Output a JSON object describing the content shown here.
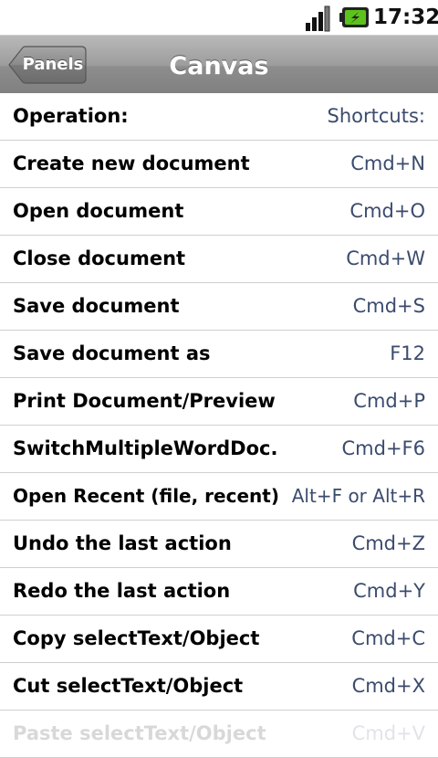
{
  "status_bar": {
    "time": "17:32",
    "icons": [
      "signal-icon",
      "battery-charging-icon"
    ]
  },
  "title_bar": {
    "back_label": "Panels",
    "title": "Canvas"
  },
  "header": {
    "operation": "Operation:",
    "shortcut": "Shortcuts:"
  },
  "rows": [
    {
      "operation": "Create new document",
      "shortcut": "Cmd+N"
    },
    {
      "operation": "Open document",
      "shortcut": "Cmd+O"
    },
    {
      "operation": "Close document",
      "shortcut": "Cmd+W"
    },
    {
      "operation": "Save document",
      "shortcut": "Cmd+S"
    },
    {
      "operation": "Save document as",
      "shortcut": "F12"
    },
    {
      "operation": "Print Document/Preview",
      "shortcut": "Cmd+P"
    },
    {
      "operation": "SwitchMultipleWordDoc.",
      "shortcut": "Cmd+F6"
    },
    {
      "operation": "Open Recent (file, recent)",
      "shortcut": "Alt+F or Alt+R"
    },
    {
      "operation": "Undo the last action",
      "shortcut": "Cmd+Z"
    },
    {
      "operation": "Redo the last action",
      "shortcut": "Cmd+Y"
    },
    {
      "operation": "Copy selectText/Object",
      "shortcut": "Cmd+C"
    },
    {
      "operation": "Cut selectText/Object",
      "shortcut": "Cmd+X"
    },
    {
      "operation": "Paste selectText/Object",
      "shortcut": "Cmd+V"
    }
  ],
  "colors": {
    "title_bar": "#9c9c9c",
    "shortcut_text": "#3b4b6e",
    "battery_accent": "#5cc21c"
  }
}
